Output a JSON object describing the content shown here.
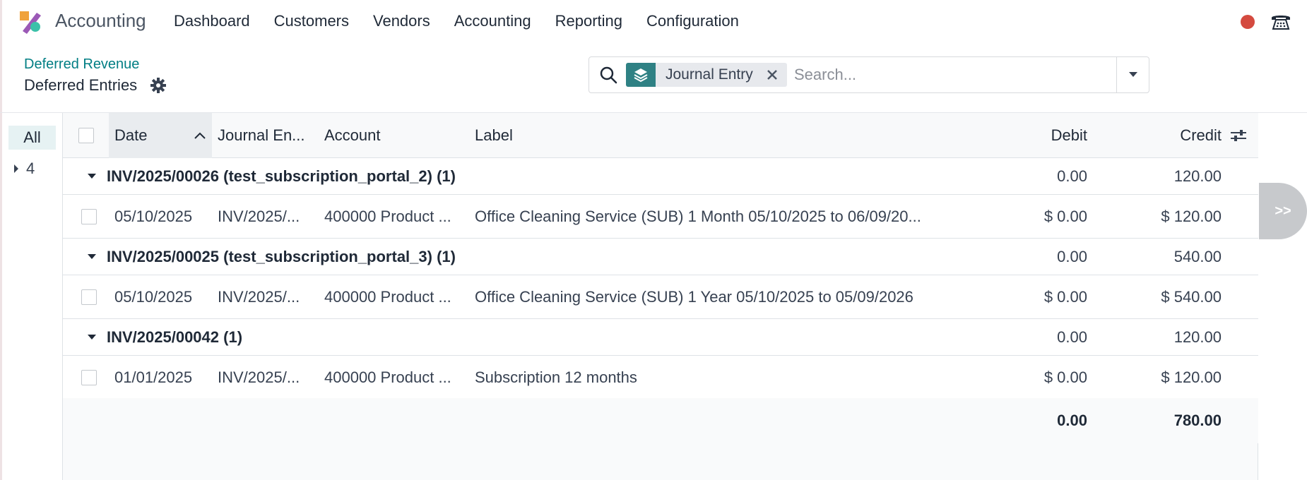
{
  "navbar": {
    "app_name": "Accounting",
    "menu": [
      "Dashboard",
      "Customers",
      "Vendors",
      "Accounting",
      "Reporting",
      "Configuration"
    ],
    "status_color": "#d44a3f"
  },
  "control_panel": {
    "breadcrumb_parent": "Deferred Revenue",
    "breadcrumb_current": "Deferred Entries"
  },
  "search": {
    "facet_label": "Journal Entry",
    "placeholder": "Search..."
  },
  "side_panel": {
    "all_label": "All",
    "group_label": "4"
  },
  "table": {
    "headers": {
      "date": "Date",
      "journal_entry": "Journal En...",
      "account": "Account",
      "label": "Label",
      "debit": "Debit",
      "credit": "Credit"
    },
    "groups": [
      {
        "title": "INV/2025/00026 (test_subscription_portal_2) (1)",
        "debit": "0.00",
        "credit": "120.00",
        "row": {
          "date": "05/10/2025",
          "journal_entry": "INV/2025/...",
          "account": "400000 Product ...",
          "label": "Office Cleaning Service (SUB) 1 Month 05/10/2025 to 06/09/20...",
          "debit": "$ 0.00",
          "credit": "$ 120.00"
        }
      },
      {
        "title": "INV/2025/00025 (test_subscription_portal_3) (1)",
        "debit": "0.00",
        "credit": "540.00",
        "row": {
          "date": "05/10/2025",
          "journal_entry": "INV/2025/...",
          "account": "400000 Product ...",
          "label": "Office Cleaning Service (SUB) 1 Year 05/10/2025 to 05/09/2026",
          "debit": "$ 0.00",
          "credit": "$ 540.00"
        }
      },
      {
        "title": "INV/2025/00042 (1)",
        "debit": "0.00",
        "credit": "120.00",
        "row": {
          "date": "01/01/2025",
          "journal_entry": "INV/2025/...",
          "account": "400000 Product ...",
          "label": "Subscription 12 months",
          "debit": "$ 0.00",
          "credit": "$ 120.00"
        }
      }
    ],
    "totals": {
      "debit": "0.00",
      "credit": "780.00"
    }
  },
  "chatter_toggle": ">>"
}
